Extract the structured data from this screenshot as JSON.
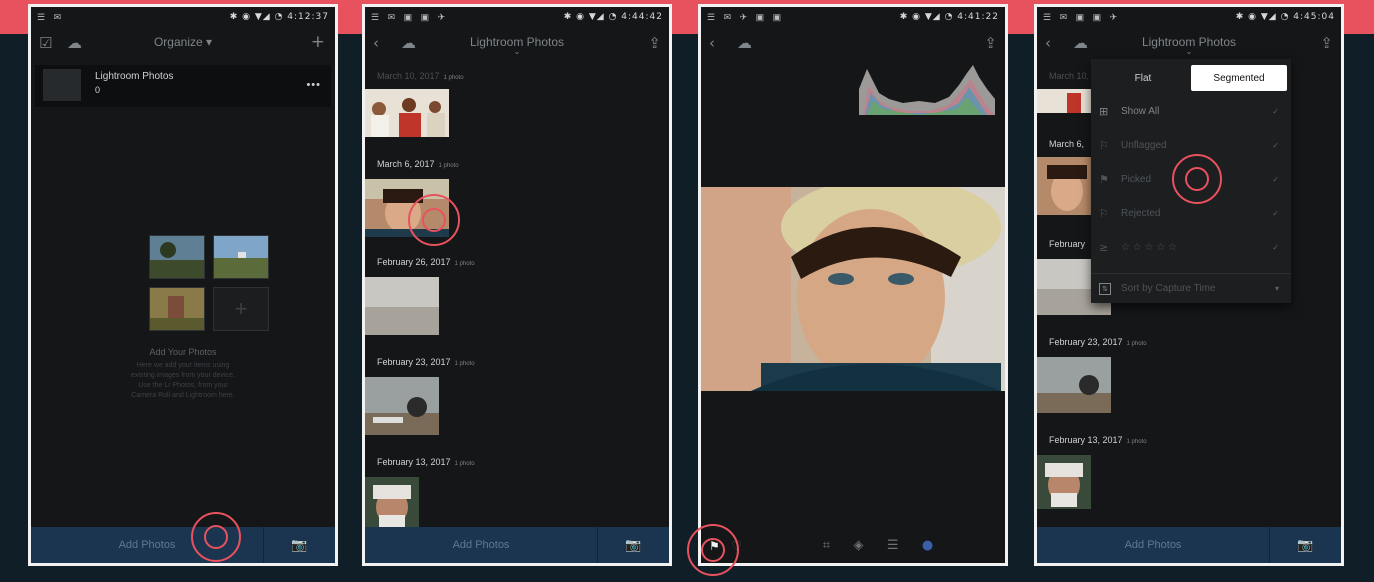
{
  "phone1": {
    "status": {
      "left": "☰ ✉",
      "time": "4:12:37"
    },
    "nav": {
      "title": "Organize ▾",
      "plus": "+"
    },
    "album": {
      "name": "Lightroom Photos",
      "count": "0",
      "more": "•••"
    },
    "add_photos_title": "Add Your Photos",
    "add_photos_desc": "Here we add your items using existing images from your device. Use the Lr Photos, from your Camera Roll and Lightroom here.",
    "plus_tile": "+",
    "bottom": {
      "add_label": "Add Photos",
      "camera_icon": "camera-icon"
    }
  },
  "phone2": {
    "status": {
      "left": "☰ ✉ ▣ ▣ ✈",
      "time": "4:44:42"
    },
    "nav": {
      "title": "Lightroom Photos"
    },
    "groups": [
      {
        "date": "March 10, 2017",
        "count": "1 photo"
      },
      {
        "date": "March 6, 2017",
        "count": "1 photo"
      },
      {
        "date": "February 26, 2017",
        "count": "1 photo"
      },
      {
        "date": "February 23, 2017",
        "count": "1 photo"
      },
      {
        "date": "February 13, 2017",
        "count": "1 photo"
      }
    ],
    "bottom": {
      "add_label": "Add Photos"
    }
  },
  "phone3": {
    "status": {
      "left": "☰ ✉ ✈ ▣ ▣",
      "time": "4:41:22"
    }
  },
  "phone4": {
    "status": {
      "left": "☰ ✉ ▣ ▣ ✈",
      "time": "4:45:04"
    },
    "nav": {
      "title": "Lightroom Photos"
    },
    "filter": {
      "tabs": [
        "Flat",
        "Segmented"
      ],
      "rows": [
        {
          "icon": "⊞",
          "label": "Show All",
          "check": "✓"
        },
        {
          "icon": "⚐",
          "label": "Unflagged",
          "check": "✓"
        },
        {
          "icon": "⚑",
          "label": "Picked",
          "check": "✓"
        },
        {
          "icon": "⚐",
          "label": "Rejected",
          "check": "✓"
        },
        {
          "icon": "≥",
          "label": "☆ ☆ ☆ ☆ ☆",
          "check": "✓"
        }
      ],
      "sort": {
        "label": "Sort by Capture Time",
        "caret": "▾"
      }
    },
    "groups": [
      {
        "date": "March 10,",
        "count": ""
      },
      {
        "date": "March 6,",
        "count": ""
      },
      {
        "date": "February",
        "count": ""
      },
      {
        "date": "February 23, 2017",
        "count": "1 photo"
      },
      {
        "date": "February 13, 2017",
        "count": "1 photo"
      }
    ],
    "bottom": {
      "add_label": "Add Photos"
    }
  },
  "colors": {
    "accent": "#e8525e",
    "background": "#0f1e27",
    "bottombar": "#1b3550"
  }
}
